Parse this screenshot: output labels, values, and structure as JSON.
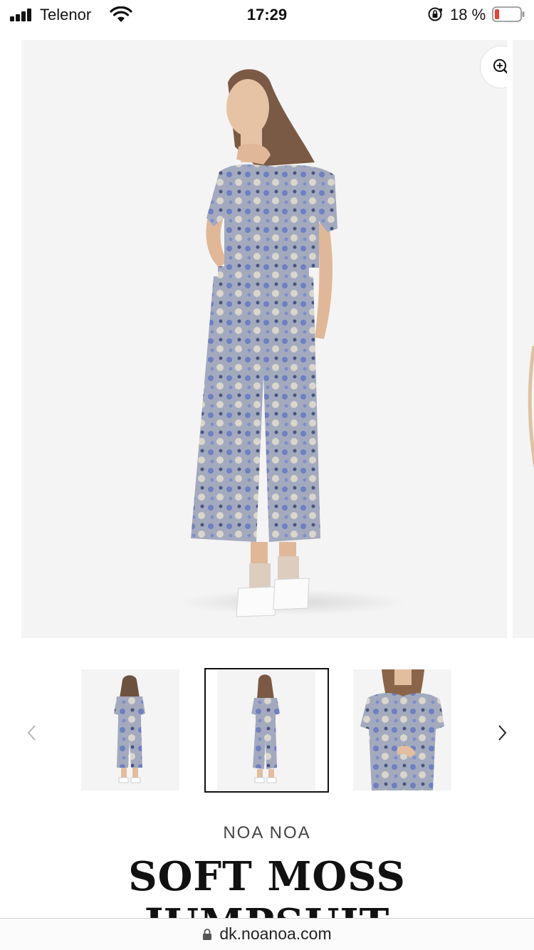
{
  "status": {
    "carrier": "Telenor",
    "time": "17:29",
    "battery_percent": "18 %",
    "battery_level": 0.18,
    "battery_color": "#e5443a"
  },
  "gallery": {
    "zoom_icon": "zoom-in-icon",
    "main_image": "model-back-view-jumpsuit"
  },
  "thumbnails": [
    {
      "image": "model-front-view-jumpsuit",
      "selected": false
    },
    {
      "image": "model-back-view-jumpsuit",
      "selected": true
    },
    {
      "image": "model-closeup-top-jumpsuit",
      "selected": false
    }
  ],
  "product": {
    "brand": "NOA NOA",
    "title": "SOFT MOSS JUMPSUIT"
  },
  "browser": {
    "url": "dk.noanoa.com"
  },
  "colors": {
    "photo_bg": "#f4f4f4",
    "garment": "#8f9ab8"
  }
}
